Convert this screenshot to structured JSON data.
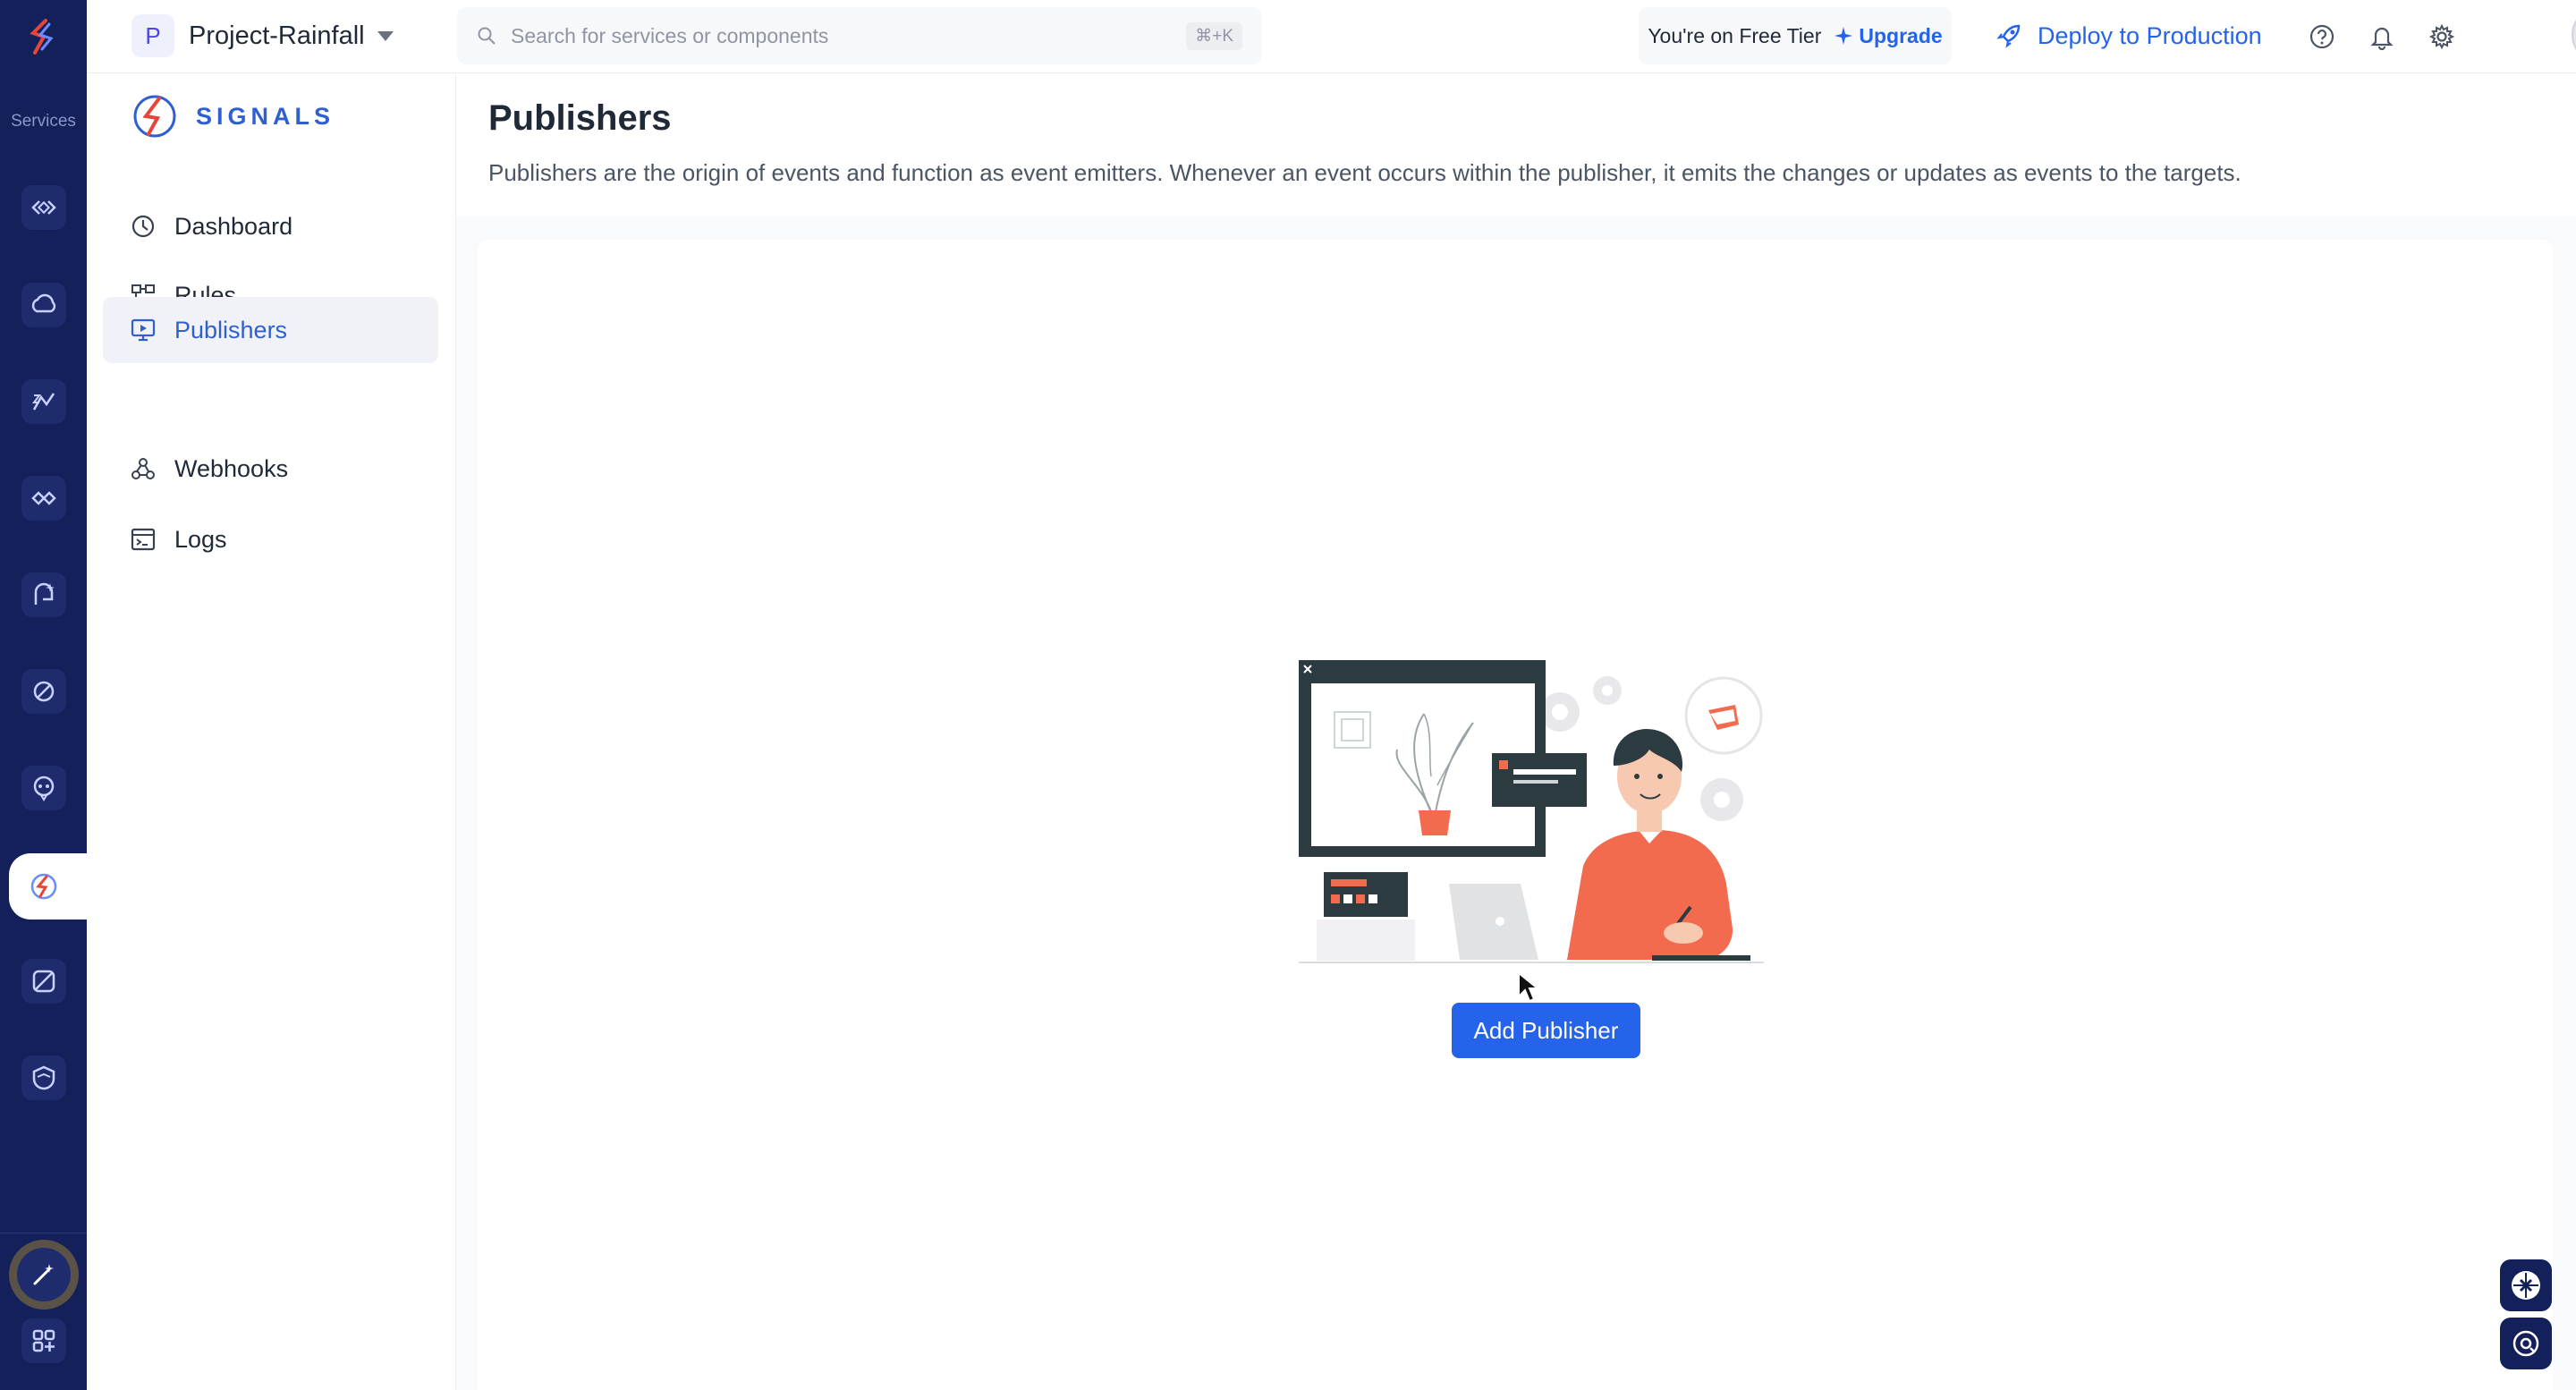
{
  "rail": {
    "label": "Services",
    "items": [
      {
        "icon": "code-brackets-icon"
      },
      {
        "icon": "cloud-functions-icon"
      },
      {
        "icon": "analytics-icon"
      },
      {
        "icon": "integrations-icon"
      },
      {
        "icon": "ai-icon"
      },
      {
        "icon": "api-icon"
      },
      {
        "icon": "bot-icon"
      },
      {
        "icon": "signals-icon"
      },
      {
        "icon": "pipelines-icon"
      },
      {
        "icon": "security-icon"
      }
    ],
    "active_index": 7
  },
  "header": {
    "project_initial": "P",
    "project_name": "Project-Rainfall",
    "search_placeholder": "Search for services or components",
    "search_shortcut": "⌘+K",
    "tier_text": "You're on Free Tier",
    "upgrade_label": "Upgrade",
    "deploy_label": "Deploy to Production"
  },
  "sidebar": {
    "brand": "SIGNALS",
    "items": [
      {
        "label": "Dashboard",
        "icon": "dashboard-icon"
      },
      {
        "label": "Rules",
        "icon": "rules-icon"
      },
      {
        "label": "Publishers",
        "icon": "publishers-icon",
        "active": true
      },
      {
        "label": "Webhooks",
        "icon": "webhooks-icon"
      },
      {
        "label": "Logs",
        "icon": "logs-icon"
      }
    ]
  },
  "main": {
    "title": "Publishers",
    "description": "Publishers are the origin of events and function as event emitters. Whenever an event occurs within the publisher, it emits the changes or updates as events to the targets.",
    "empty_action": "Add Publisher"
  },
  "colors": {
    "rail": "#14205a",
    "accent": "#2563eb",
    "brand": "#2f5fd0",
    "illustration_orange": "#f26b4f"
  }
}
